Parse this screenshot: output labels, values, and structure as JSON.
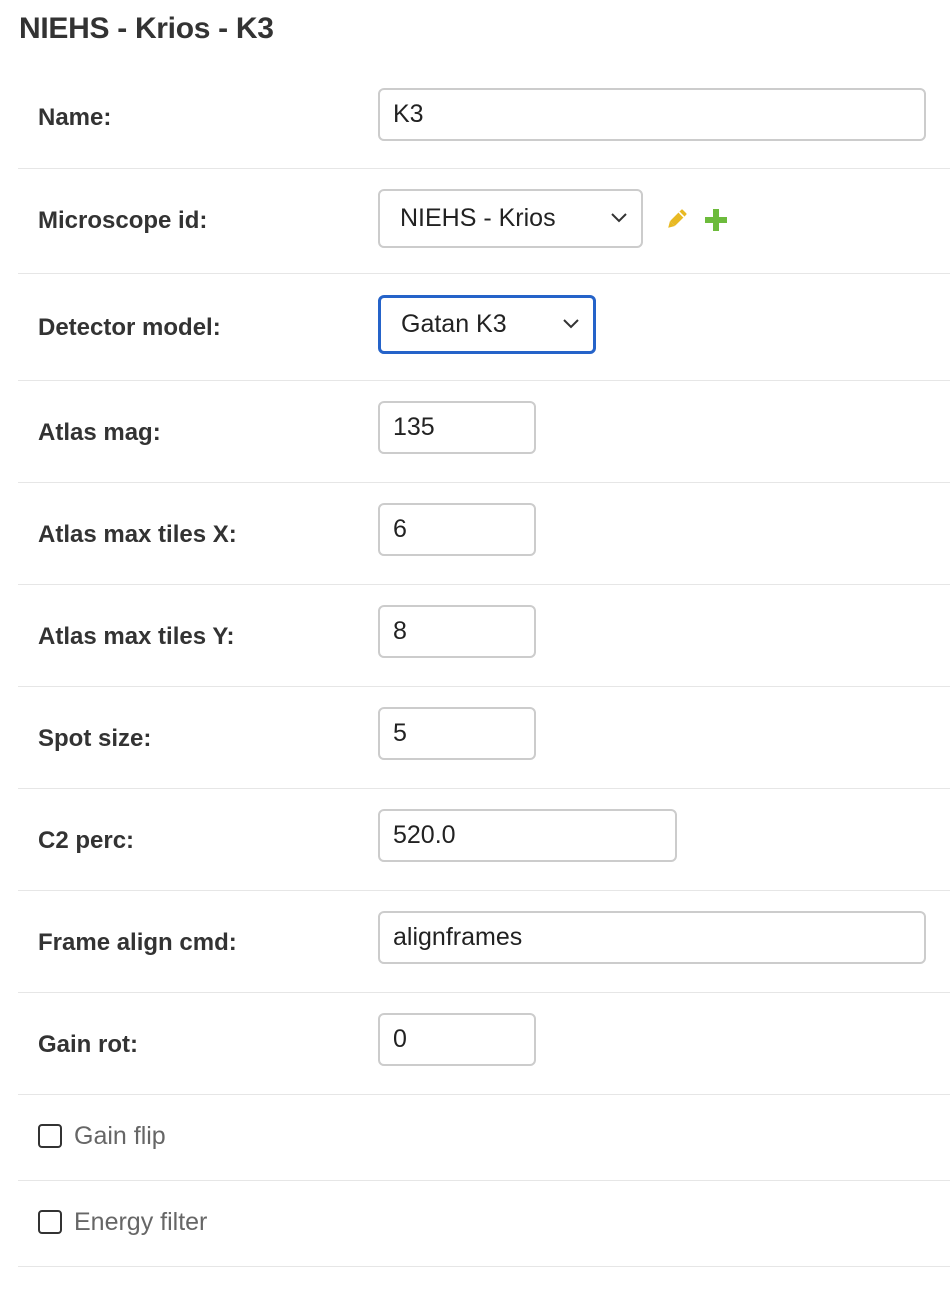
{
  "page_title": "NIEHS - Krios - K3",
  "fields": {
    "name": {
      "label": "Name:",
      "value": "K3"
    },
    "microscope_id": {
      "label": "Microscope id:",
      "value": "NIEHS - Krios",
      "icons": [
        "pencil-icon",
        "plus-icon"
      ]
    },
    "detector_model": {
      "label": "Detector model:",
      "value": "Gatan K3"
    },
    "atlas_mag": {
      "label": "Atlas mag:",
      "value": "135"
    },
    "atlas_max_tiles_x": {
      "label": "Atlas max tiles X:",
      "value": "6"
    },
    "atlas_max_tiles_y": {
      "label": "Atlas max tiles Y:",
      "value": "8"
    },
    "spot_size": {
      "label": "Spot size:",
      "value": "5"
    },
    "c2_perc": {
      "label": "C2 perc:",
      "value": "520.0"
    },
    "frame_align_cmd": {
      "label": "Frame align cmd:",
      "value": "alignframes"
    },
    "gain_rot": {
      "label": "Gain rot:",
      "value": "0"
    }
  },
  "checkboxes": {
    "gain_flip": {
      "label": "Gain flip",
      "checked": false
    },
    "energy_filter": {
      "label": "Energy filter",
      "checked": false
    }
  },
  "colors": {
    "focus_border": "#2563c9",
    "edit_icon": "#e8b923",
    "add_icon": "#6dbb3c"
  }
}
